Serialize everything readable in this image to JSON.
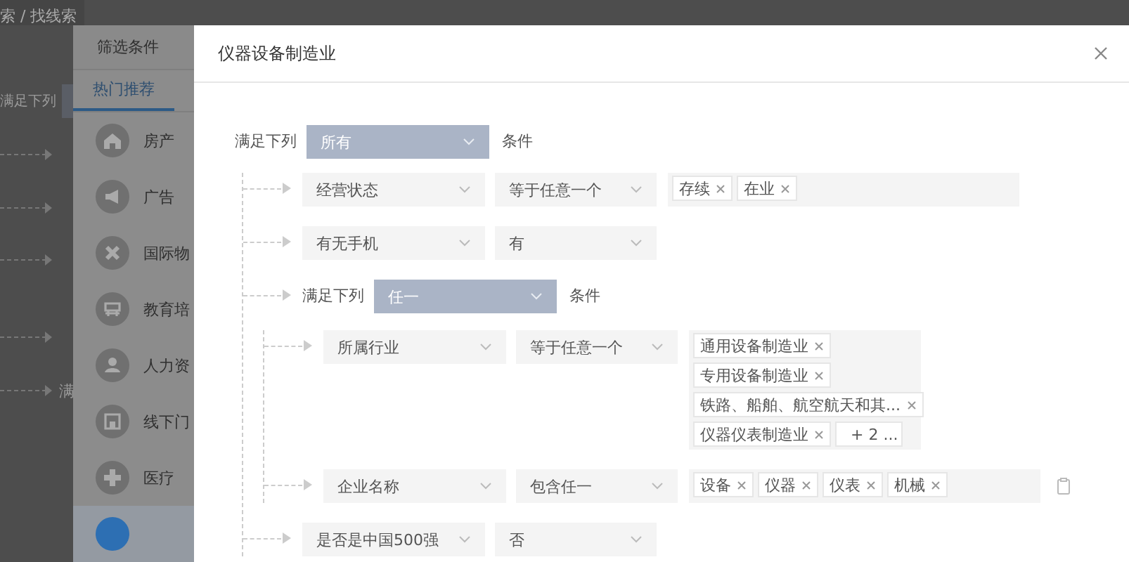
{
  "background": {
    "breadcrumb": "索 / 找线索",
    "labels": [
      "满足下列",
      "满"
    ]
  },
  "filter_panel": {
    "title": "筛选条件",
    "tabs": [
      {
        "label": "热门推荐",
        "selected": true
      }
    ],
    "items": [
      {
        "label": "房产",
        "selected": false
      },
      {
        "label": "广告",
        "selected": false
      },
      {
        "label": "国际物",
        "selected": false
      },
      {
        "label": "教育培",
        "selected": false
      },
      {
        "label": "人力资",
        "selected": false
      },
      {
        "label": "线下门",
        "selected": false
      },
      {
        "label": "医疗",
        "selected": false
      },
      {
        "selected": true
      }
    ]
  },
  "dialog": {
    "title": "仪器设备制造业",
    "rules": {
      "kind": "group",
      "label": "满足下列",
      "match": "所有",
      "suffix": "条件",
      "children": [
        {
          "kind": "condition",
          "field": "经营状态",
          "operator": "等于任意一个",
          "tags": [
            "存续",
            "在业"
          ]
        },
        {
          "kind": "condition",
          "field": "有无手机",
          "operator": "有"
        },
        {
          "kind": "group",
          "label": "满足下列",
          "match": "任一",
          "suffix": "条件",
          "children": [
            {
              "kind": "condition",
              "field": "所属行业",
              "operator": "等于任意一个",
              "tags": [
                "通用设备制造业",
                "专用设备制造业",
                "铁路、船舶、航空航天和其...",
                "仪器仪表制造业"
              ],
              "more": "+ 2 ..."
            },
            {
              "kind": "condition",
              "field": "企业名称",
              "operator": "包含任一",
              "tags": [
                "设备",
                "仪器",
                "仪表",
                "机械"
              ],
              "paste_button": true
            }
          ]
        },
        {
          "kind": "condition",
          "field": "是否是中国500强",
          "operator": "否"
        }
      ]
    }
  }
}
